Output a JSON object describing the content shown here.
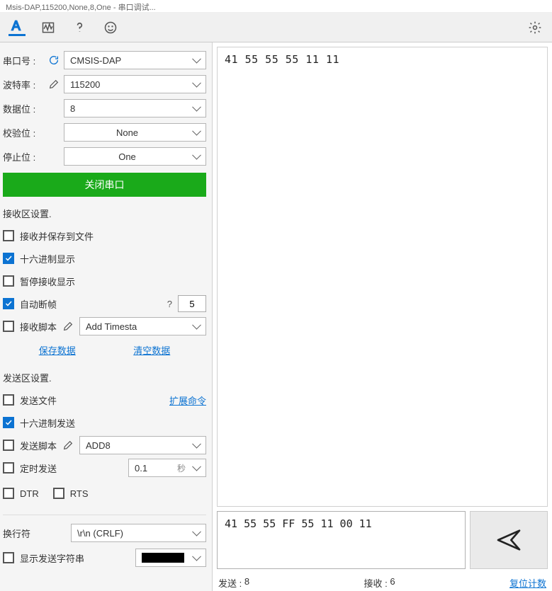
{
  "title": "Msis-DAP,115200,None,8,One - 串口调试...",
  "port": {
    "label": "串口号 :",
    "value": "CMSIS-DAP"
  },
  "baud": {
    "label": "波特率 :",
    "value": "115200"
  },
  "databits": {
    "label": "数据位 :",
    "value": "8"
  },
  "parity": {
    "label": "校验位 :",
    "value": "None"
  },
  "stopbits": {
    "label": "停止位 :",
    "value": "One"
  },
  "close_btn": "关闭串口",
  "rx_section": "接收区设置.",
  "rx_opts": {
    "save_file": "接收并保存到文件",
    "hex_display": "十六进制显示",
    "pause": "暂停接收显示",
    "auto_frame": "自动断帧",
    "auto_frame_help": "?",
    "auto_frame_val": "5",
    "rx_script": "接收脚本",
    "rx_script_sel": "Add Timesta"
  },
  "save_data": "保存数据",
  "clear_data": "清空数据",
  "tx_section": "发送区设置.",
  "tx_opts": {
    "send_file": "发送文件",
    "ext_cmd": "扩展命令",
    "hex_send": "十六进制发送",
    "tx_script": "发送脚本",
    "tx_script_sel": "ADD8",
    "timed_send": "定时发送",
    "timed_val": "0.1",
    "timed_unit": "秒",
    "dtr": "DTR",
    "rts": "RTS"
  },
  "newline": {
    "label": "换行符",
    "value": "\\r\\n (CRLF)"
  },
  "show_tx_str": "显示发送字符串",
  "rx_content": "41 55 55 55 11 11",
  "tx_content": "41 55 55 FF 55 11 00 11",
  "status": {
    "tx_label": "发送 :",
    "tx_count": "8",
    "rx_label": "接收 :",
    "rx_count": "6",
    "reset": "复位计数"
  }
}
